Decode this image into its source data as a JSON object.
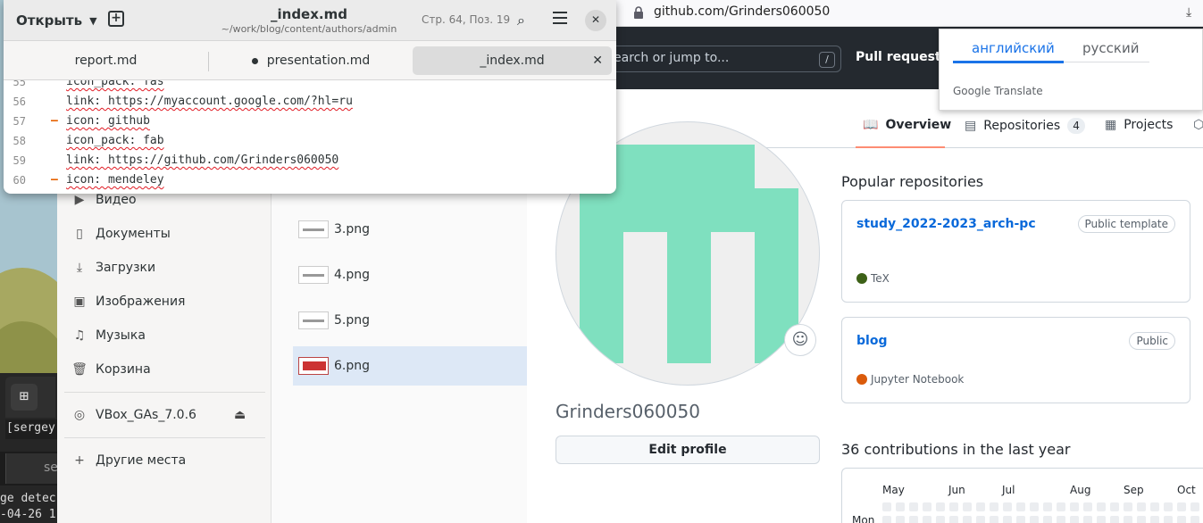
{
  "terminal": {
    "prompt": "[sergey",
    "tab_label": "se",
    "log_line_1": "ge detec",
    "log_line_2": "-04-26 1"
  },
  "files": {
    "sidebar": [
      {
        "label": "Видео",
        "icon": "video-icon"
      },
      {
        "label": "Документы",
        "icon": "document-icon"
      },
      {
        "label": "Загрузки",
        "icon": "download-icon"
      },
      {
        "label": "Изображения",
        "icon": "image-icon"
      },
      {
        "label": "Музыка",
        "icon": "music-icon"
      },
      {
        "label": "Корзина",
        "icon": "trash-icon"
      }
    ],
    "device": {
      "label": "VBox_GAs_7.0.6",
      "icon": "disc-icon"
    },
    "other_places": {
      "label": "Другие места",
      "icon": "plus-icon"
    },
    "list": [
      {
        "name": "3.png"
      },
      {
        "name": "4.png"
      },
      {
        "name": "5.png"
      },
      {
        "name": "6.png",
        "selected": true
      }
    ]
  },
  "browser": {
    "url": "github.com/Grinders060050",
    "search_placeholder": "earch or jump to...",
    "search_key": "/",
    "pull_requests": "Pull requests",
    "tabs": [
      {
        "label": "Overview",
        "icon": "book-icon",
        "active": true
      },
      {
        "label": "Repositories",
        "icon": "repo-icon",
        "count": "4"
      },
      {
        "label": "Projects",
        "icon": "table-icon"
      }
    ],
    "username": "Grinders060050",
    "edit_profile": "Edit profile",
    "popular_title": "Popular repositories",
    "repos": [
      {
        "name": "study_2022-2023_arch-pc",
        "badge": "Public template",
        "language": "TeX",
        "lang_color": "#3D6117"
      },
      {
        "name": "blog",
        "badge": "Public",
        "language": "Jupyter Notebook",
        "lang_color": "#DA5B0B"
      }
    ],
    "contrib_title": "36 contributions in the last year",
    "months": [
      "May",
      "Jun",
      "Jul",
      "Aug",
      "Sep",
      "Oct"
    ],
    "day_label": "Mon",
    "translate": {
      "active_lang": "английский",
      "other_lang": "русский",
      "powered": "Google Translate"
    }
  },
  "editor": {
    "open_label": "Открыть",
    "title": "_index.md",
    "path": "~/work/blog/content/authors/admin",
    "position": "Стр. 64, Поз. 19",
    "tabs": [
      {
        "label": "report.md"
      },
      {
        "label": "presentation.md",
        "modified": true
      },
      {
        "label": "_index.md",
        "active": true
      }
    ],
    "lines": [
      {
        "n": "55",
        "text": "icon_pack: fas",
        "changed": false
      },
      {
        "n": "56",
        "text": "link: https://myaccount.google.com/?hl=ru",
        "changed": false
      },
      {
        "n": "57",
        "text": "icon: github",
        "changed": true
      },
      {
        "n": "58",
        "text": "icon_pack: fab",
        "changed": false
      },
      {
        "n": "59",
        "text": "link: https://github.com/Grinders060050",
        "changed": false
      },
      {
        "n": "60",
        "text": "icon: mendeley",
        "changed": true
      }
    ]
  },
  "colors": {
    "accent_blue": "#0969da",
    "gh_header": "#24292f",
    "avatar_green": "#7fe0bf",
    "change_marker": "#e66100"
  }
}
